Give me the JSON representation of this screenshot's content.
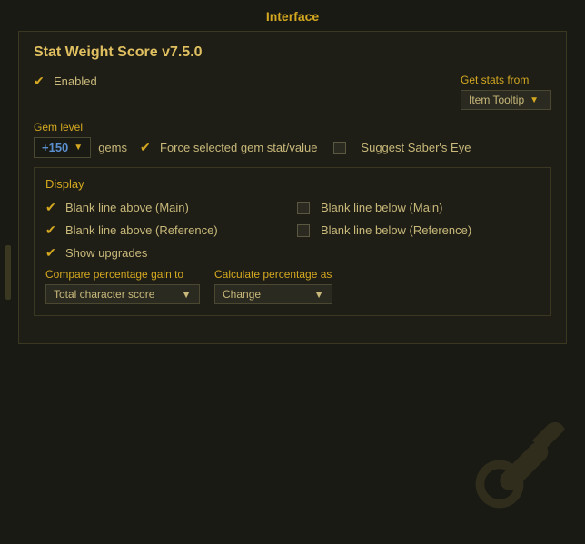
{
  "header": {
    "title": "Interface"
  },
  "panel": {
    "title": "Stat Weight Score v7.5.0",
    "enabled_label": "Enabled",
    "get_stats": {
      "label": "Get stats from",
      "value": "Item Tooltip"
    },
    "gem_level": {
      "label": "Gem level",
      "value": "+150",
      "suffix": "gems"
    },
    "force_gem": {
      "label": "Force selected gem stat/value",
      "checked": true
    },
    "suggest_eye": {
      "label": "Suggest Saber's Eye",
      "checked": false
    },
    "display": {
      "title": "Display",
      "blank_above_main": {
        "label": "Blank line above (Main)",
        "checked": true
      },
      "blank_below_main": {
        "label": "Blank line below (Main)",
        "checked": false
      },
      "blank_above_ref": {
        "label": "Blank line above (Reference)",
        "checked": true
      },
      "blank_below_ref": {
        "label": "Blank line below (Reference)",
        "checked": false
      },
      "show_upgrades": {
        "label": "Show upgrades",
        "checked": true
      }
    },
    "compare": {
      "label": "Compare percentage gain to",
      "value": "Total character score"
    },
    "calculate": {
      "label": "Calculate percentage as",
      "value": "Change"
    }
  }
}
